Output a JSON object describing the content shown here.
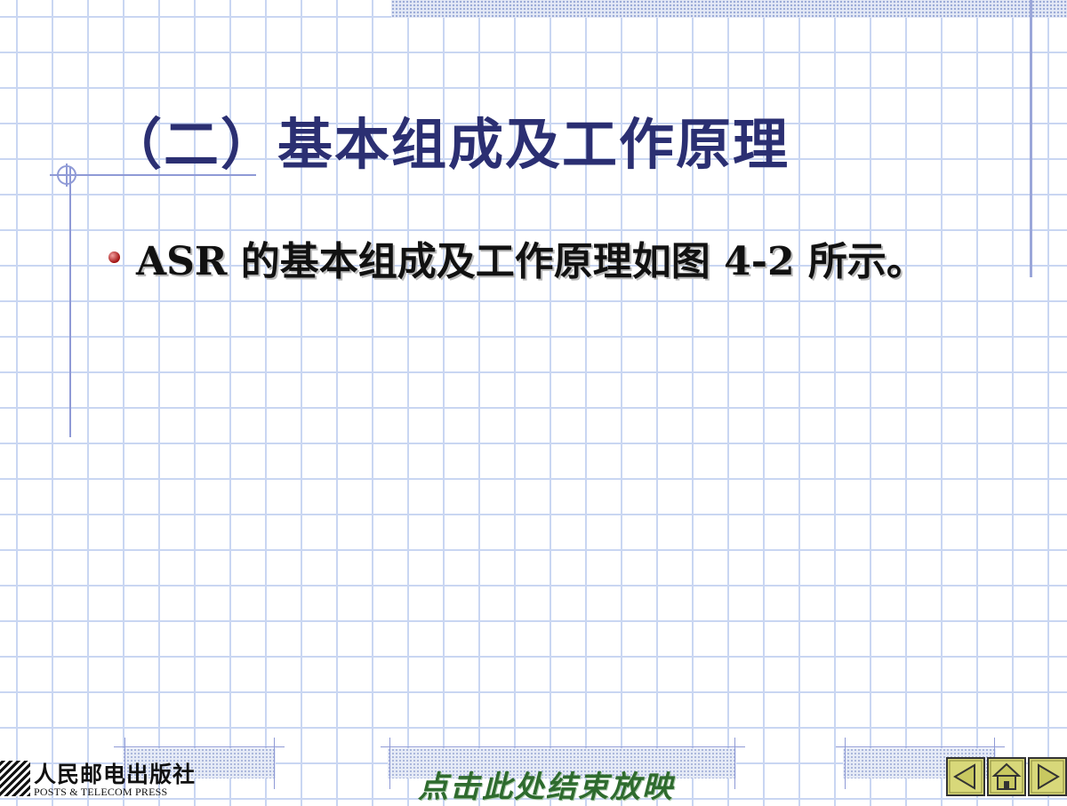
{
  "slide": {
    "title": "（二）基本组成及工作原理",
    "bullets": [
      {
        "text": "ASR 的基本组成及工作原理如图 4-2 所示。"
      }
    ]
  },
  "footer": {
    "publisher_cn": "人民邮电出版社",
    "publisher_en": "POSTS & TELECOM PRESS",
    "end_show_label": "点击此处结束放映"
  },
  "nav": {
    "prev_icon": "triangle-left-icon",
    "home_icon": "home-icon",
    "next_icon": "triangle-right-icon"
  },
  "colors": {
    "title": "#2b2f72",
    "grid": "#c9d6f2",
    "accent_rule": "#8f9ad6",
    "bullet": "#a01010",
    "end_show": "#2e6b2e",
    "nav_fill": "#d8d87a"
  }
}
